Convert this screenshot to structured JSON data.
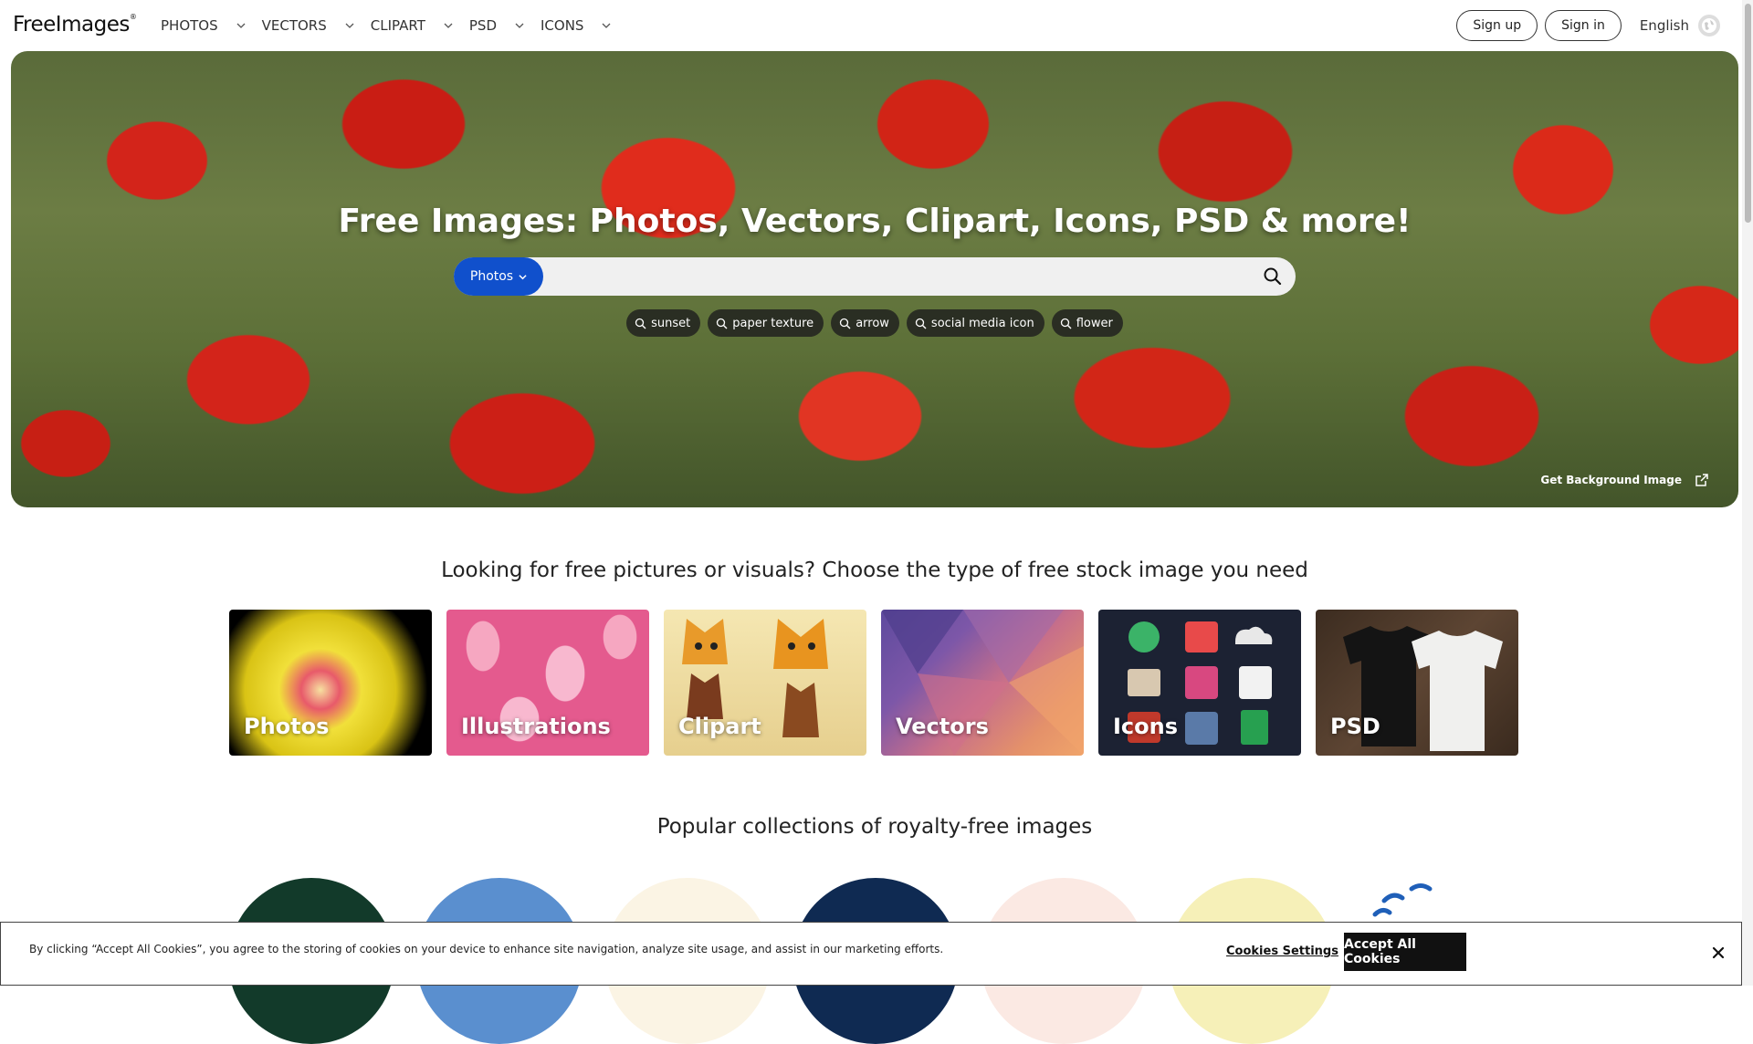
{
  "header": {
    "logo": "FreeImages",
    "logo_mark": "®",
    "nav": [
      {
        "label": "PHOTOS"
      },
      {
        "label": "VECTORS"
      },
      {
        "label": "CLIPART"
      },
      {
        "label": "PSD"
      },
      {
        "label": "ICONS"
      }
    ],
    "signup": "Sign up",
    "signin": "Sign in",
    "language": "English"
  },
  "hero": {
    "title": "Free Images: Photos, Vectors, Clipart, Icons, PSD & more!",
    "search_type": "Photos",
    "search_placeholder": "",
    "tags": [
      "sunset",
      "paper texture",
      "arrow",
      "social media icon",
      "flower"
    ],
    "bg_credit": "Get Background Image"
  },
  "types_section": {
    "title": "Looking for free pictures or visuals? Choose the type of free stock image you need",
    "cards": [
      {
        "label": "Photos"
      },
      {
        "label": "Illustrations"
      },
      {
        "label": "Clipart"
      },
      {
        "label": "Vectors"
      },
      {
        "label": "Icons"
      },
      {
        "label": "PSD"
      }
    ]
  },
  "collections_section": {
    "title": "Popular collections of royalty-free images"
  },
  "cookie": {
    "text": "By clicking “Accept All Cookies”, you agree to the storing of cookies on your device to enhance site navigation, analyze site usage, and assist in our marketing efforts.",
    "settings": "Cookies Settings",
    "accept": "Accept All Cookies"
  },
  "colors": {
    "accent": "#1050cc",
    "cookie_button": "#111111"
  }
}
